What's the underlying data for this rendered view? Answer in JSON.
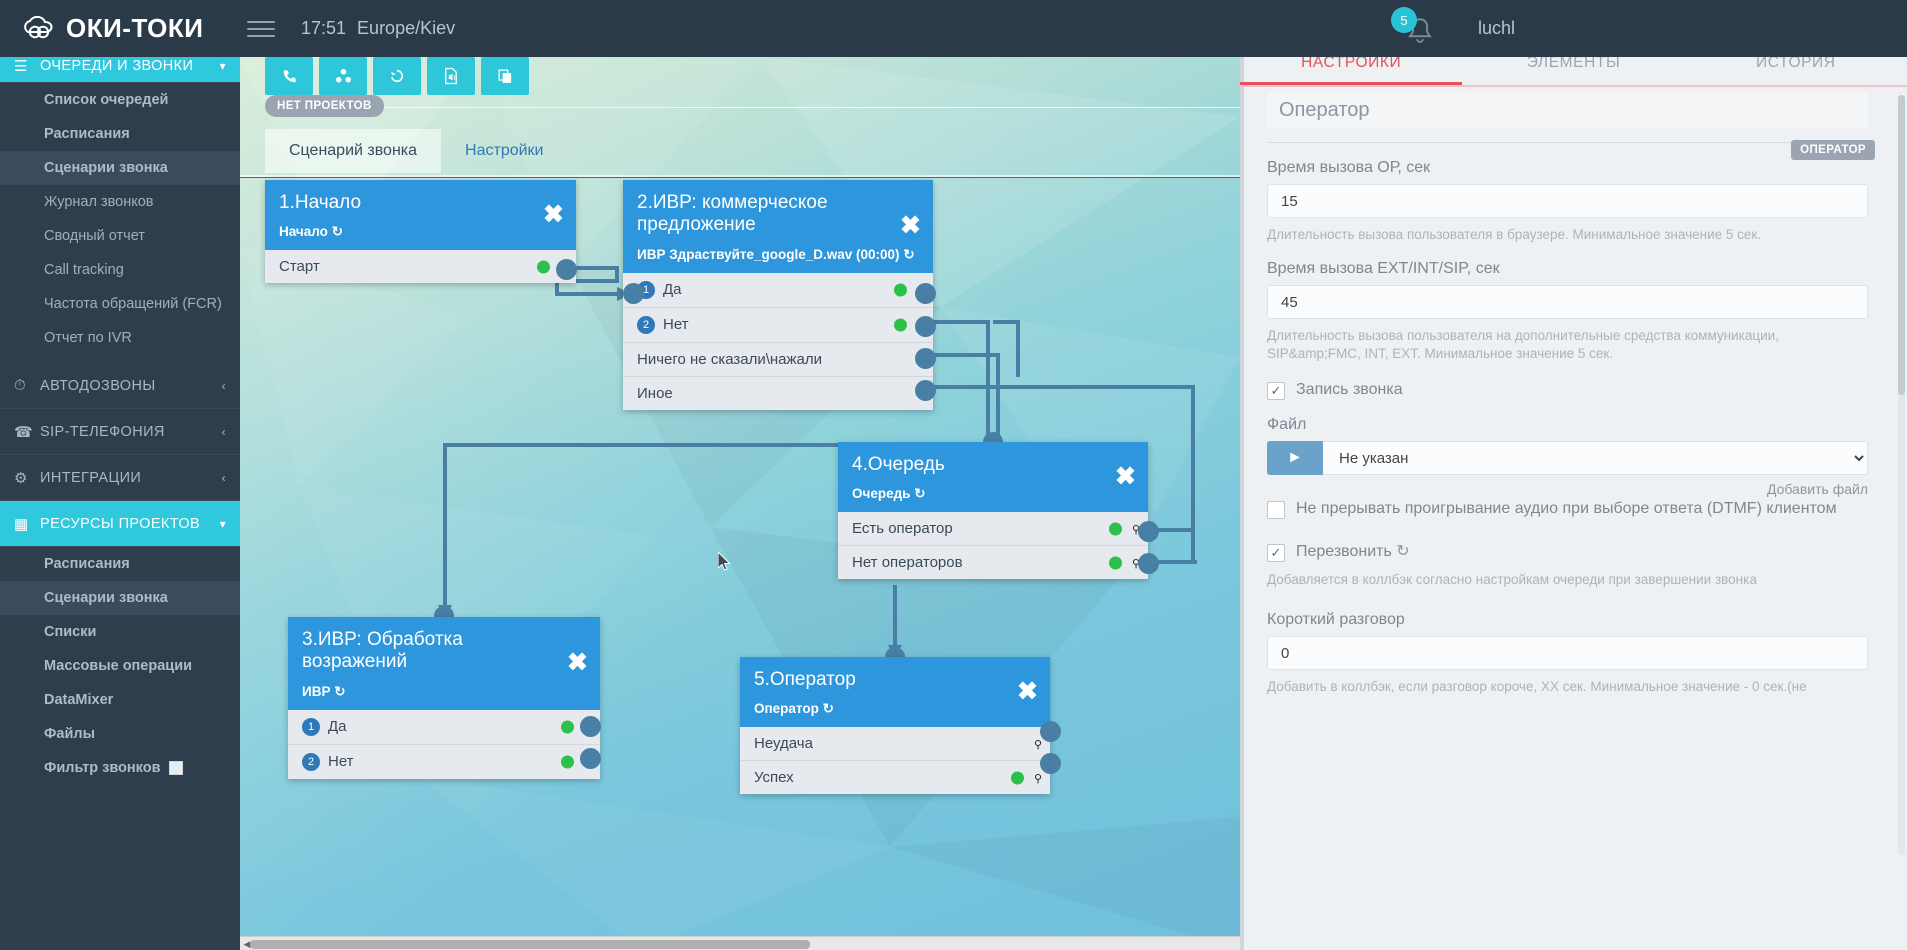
{
  "topbar": {
    "brand": "ОКИ-ТОКИ",
    "time": "17:51",
    "timezone": "Europe/Kiev",
    "notification_count": "5",
    "username": "luchl",
    "menu_icon": "hamburger-icon",
    "bell_icon": "bell-icon"
  },
  "sidebar": {
    "groups": [
      {
        "label": "ОЧЕРЕДИ И ЗВОНКИ",
        "icon": "list-icon",
        "active": true,
        "items": [
          {
            "label": "Список очередей",
            "bold": true,
            "selected": false
          },
          {
            "label": "Расписания",
            "bold": true,
            "selected": false
          },
          {
            "label": "Сценарии звонка",
            "bold": true,
            "selected": true
          },
          {
            "label": "Журнал звонков",
            "bold": false,
            "selected": false
          },
          {
            "label": "Сводный отчет",
            "bold": false,
            "selected": false
          },
          {
            "label": "Call tracking",
            "bold": false,
            "selected": false
          },
          {
            "label": "Частота обращений (FCR)",
            "bold": false,
            "selected": false
          },
          {
            "label": "Отчет по IVR",
            "bold": false,
            "selected": false
          }
        ]
      },
      {
        "label": "АВТОДОЗВОНЫ",
        "icon": "clock-icon",
        "active": false,
        "items": []
      },
      {
        "label": "SIP-ТЕЛЕФОНИЯ",
        "icon": "phone-icon",
        "active": false,
        "items": []
      },
      {
        "label": "ИНТЕГРАЦИИ",
        "icon": "gears-icon",
        "active": false,
        "items": []
      },
      {
        "label": "РЕСУРСЫ ПРОЕКТОВ",
        "icon": "grid-icon",
        "active": true,
        "items": [
          {
            "label": "Расписания",
            "bold": true,
            "selected": false
          },
          {
            "label": "Сценарии звонка",
            "bold": true,
            "selected": true
          },
          {
            "label": "Списки",
            "bold": true,
            "selected": false
          },
          {
            "label": "Массовые операции",
            "bold": true,
            "selected": false
          },
          {
            "label": "DataMixer",
            "bold": true,
            "selected": false
          },
          {
            "label": "Файлы",
            "bold": true,
            "selected": false
          },
          {
            "label": "Фильтр звонков",
            "bold": true,
            "selected": false,
            "checkbox": true
          }
        ]
      }
    ]
  },
  "canvas": {
    "toolbar": [
      {
        "name": "phone-icon",
        "glyph": "☎"
      },
      {
        "name": "nodes-icon",
        "glyph": "✤"
      },
      {
        "name": "history-icon",
        "glyph": "↺"
      },
      {
        "name": "audio-file-icon",
        "glyph": "♪"
      },
      {
        "name": "copy-icon",
        "glyph": "⧉"
      }
    ],
    "project_badge": "НЕТ ПРОЕКТОВ",
    "tabs": [
      {
        "label": "Сценарий звонка",
        "active": true
      },
      {
        "label": "Настройки",
        "active": false
      }
    ],
    "nodes": [
      {
        "id": "node1",
        "title": "1.Начало",
        "subtitle": "Начало",
        "rows": [
          {
            "label": "Старт",
            "num": null,
            "green": true,
            "key": true
          }
        ]
      },
      {
        "id": "node2",
        "title": "2.ИВР: коммерческое предложение",
        "subtitle": "ИВР Здраствуйте_google_D.wav (00:00)",
        "rows": [
          {
            "label": "Да",
            "num": "1",
            "green": true,
            "key": true
          },
          {
            "label": "Нет",
            "num": "2",
            "green": true,
            "key": true
          },
          {
            "label": "Ничего не сказали\\нажали",
            "num": null,
            "green": false,
            "key": true
          },
          {
            "label": "Иное",
            "num": null,
            "green": false,
            "key": true
          }
        ]
      },
      {
        "id": "node3",
        "title": "3.ИВР: Обработка возражений",
        "subtitle": "ИВР",
        "rows": [
          {
            "label": "Да",
            "num": "1",
            "green": true,
            "key": true
          },
          {
            "label": "Нет",
            "num": "2",
            "green": true,
            "key": true
          }
        ]
      },
      {
        "id": "node4",
        "title": "4.Очередь",
        "subtitle": "Очередь",
        "rows": [
          {
            "label": "Есть оператор",
            "num": null,
            "green": true,
            "key": true
          },
          {
            "label": "Нет операторов",
            "num": null,
            "green": true,
            "key": true
          }
        ]
      },
      {
        "id": "node5",
        "title": "5.Оператор",
        "subtitle": "Оператор",
        "rows": [
          {
            "label": "Неудача",
            "num": null,
            "green": false,
            "key": true
          },
          {
            "label": "Успех",
            "num": null,
            "green": true,
            "key": true
          }
        ]
      }
    ],
    "close_icon": "close-icon",
    "refresh_icon": "refresh-icon"
  },
  "rightpanel": {
    "icons": [
      {
        "name": "upload-icon",
        "glyph": "⬆"
      },
      {
        "name": "save-icon",
        "glyph": "💾"
      },
      {
        "name": "exit-icon",
        "glyph": "⮕"
      }
    ],
    "tabs": [
      {
        "label": "НАСТРОЙКИ",
        "active": true
      },
      {
        "label": "ЭЛЕМЕНТЫ",
        "active": false
      },
      {
        "label": "ИСТОРИЯ",
        "active": false
      }
    ],
    "name_value": "Оператор",
    "type_badge": "ОПЕРАТОР",
    "fields": [
      {
        "label": "Время вызова ОР, сек",
        "value": "15",
        "hint": "Длительность вызова пользователя в браузере. Минимальное значение 5 сек."
      },
      {
        "label": "Время вызова EXT/INT/SIP, сек",
        "value": "45",
        "hint": "Длительность вызова пользователя на дополнительные средства коммуникации, SIP&amp;FMC, INT, EXT. Минимальное значение 5 сек."
      }
    ],
    "record_checkbox": {
      "label": "Запись звонка",
      "checked": true
    },
    "file_label": "Файл",
    "file_value": "Не указан",
    "add_file_link": "Добавить файл",
    "dtmf_checkbox": {
      "label": "Не прерывать проигрывание аудио при выборе ответа (DTMF) клиентом",
      "checked": false
    },
    "callback_checkbox": {
      "label": "Перезвонить",
      "checked": true
    },
    "callback_hint": "Добавляется в коллбэк согласно настройкам очереди при завершении звонка",
    "short_talk_label": "Короткий разговор",
    "short_talk_value": "0",
    "short_talk_hint": "Добавить в коллбэк, если разговор короче, XX сек. Минимальное значение - 0 сек.(не"
  },
  "colors": {
    "brand_dark": "#2b3a48",
    "sidebar": "#2f3e4d",
    "accent_cyan": "#2fc8dd",
    "node_blue": "#2e96dd",
    "accent_red": "#e8505b",
    "green_dot": "#2cc14a",
    "wire": "#4a7fa5"
  }
}
